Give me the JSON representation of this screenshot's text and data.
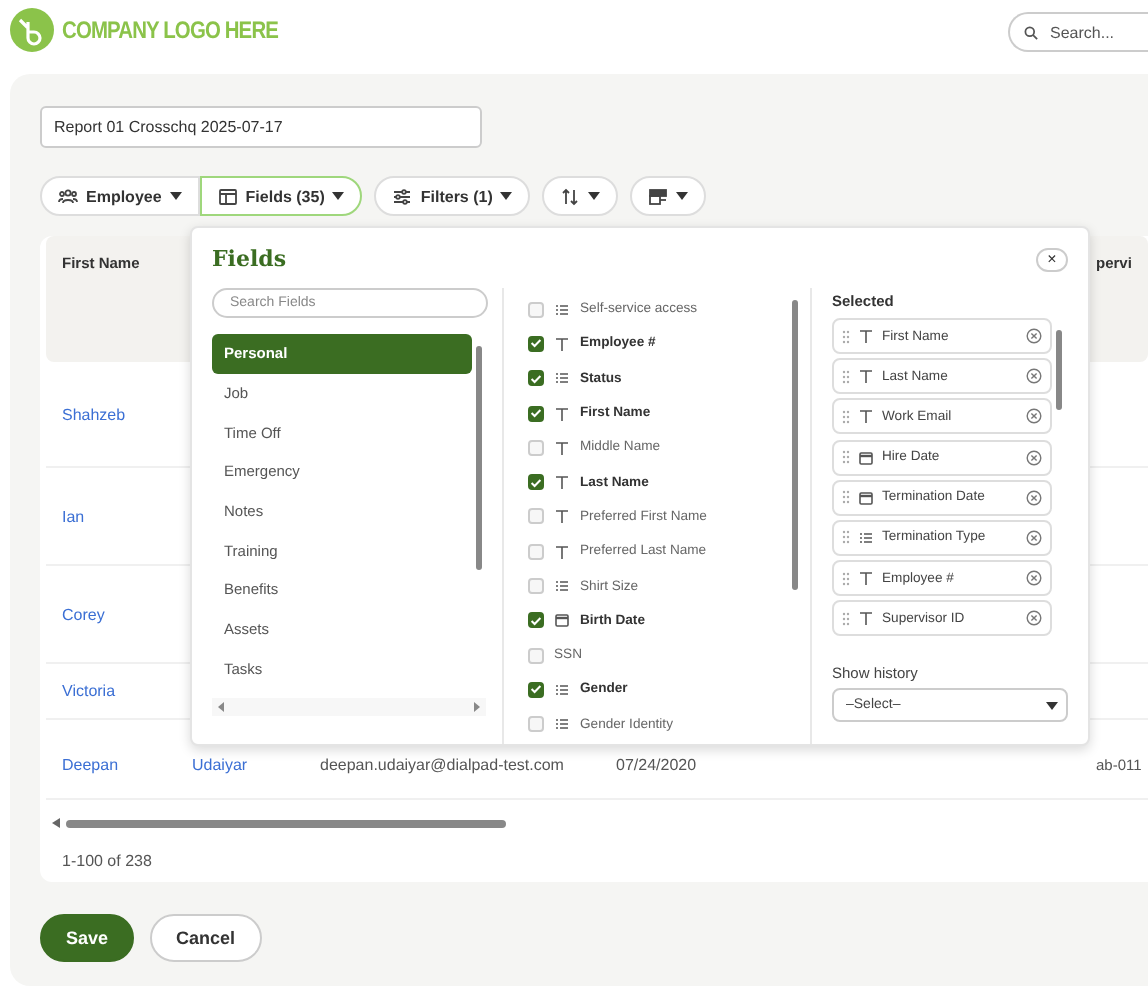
{
  "logo": {
    "text": "COMPANY LOGO HERE"
  },
  "search": {
    "placeholder": "Search..."
  },
  "report_name": {
    "value": "Report 01 Crosschq 2025-07-17"
  },
  "toolbar": {
    "segments": [
      {
        "label": "Employee",
        "selected": false
      },
      {
        "label": "Fields (35)",
        "selected": true
      }
    ],
    "buttons": [
      {
        "label": "Filters (1)"
      },
      {
        "kind": "sort"
      },
      {
        "kind": "view"
      }
    ]
  },
  "table": {
    "columns": [
      "First Name",
      "",
      "",
      "",
      "pervi"
    ],
    "rows": [
      {
        "cells": [
          "Shahzeb"
        ]
      },
      {
        "cells": [
          "Ian"
        ]
      },
      {
        "cells": [
          "Corey"
        ]
      },
      {
        "cells": [
          "Victoria"
        ]
      },
      {
        "cells": [
          "Deepan",
          "Udaiyar",
          "deepan.udaiyar@dialpad-test.com",
          "07/24/2020",
          "ab-011"
        ]
      }
    ]
  },
  "pagination": "1-100 of 238",
  "actions": [
    {
      "kind": "primary",
      "label": "Save"
    },
    {
      "kind": "secondary",
      "label": "Cancel"
    }
  ],
  "fields_panel": {
    "title": "Fields",
    "close": "×",
    "search_placeholder": "Search Fields",
    "categories": [
      {
        "label": "Personal",
        "selected": true
      },
      {
        "label": "Job",
        "selected": false
      },
      {
        "label": "Time Off",
        "selected": false
      },
      {
        "label": "Emergency",
        "selected": false
      },
      {
        "label": "Notes",
        "selected": false
      },
      {
        "label": "Training",
        "selected": false
      },
      {
        "label": "Benefits",
        "selected": false
      },
      {
        "label": "Assets",
        "selected": false
      },
      {
        "label": "Tasks",
        "selected": false
      }
    ],
    "fields": [
      {
        "label": "Self-service access",
        "kind": "list",
        "checked": false
      },
      {
        "label": "Employee #",
        "kind": "text",
        "checked": true
      },
      {
        "label": "Status",
        "kind": "list",
        "checked": true
      },
      {
        "label": "First Name",
        "kind": "text",
        "checked": true
      },
      {
        "label": "Middle Name",
        "kind": "text",
        "checked": false
      },
      {
        "label": "Last Name",
        "kind": "text",
        "checked": true
      },
      {
        "label": "Preferred First Name",
        "kind": "text",
        "checked": false
      },
      {
        "label": "Preferred Last Name",
        "kind": "text",
        "checked": false
      },
      {
        "label": "Shirt Size",
        "kind": "list",
        "checked": false
      },
      {
        "label": "Birth Date",
        "kind": "date",
        "checked": true
      },
      {
        "label": "SSN",
        "kind": "plain",
        "checked": false
      },
      {
        "label": "Gender",
        "kind": "list",
        "checked": true
      },
      {
        "label": "Gender Identity",
        "kind": "list",
        "checked": false
      }
    ],
    "selected_title": "Selected",
    "selected_fields": [
      {
        "label": "First Name",
        "kind": "text"
      },
      {
        "label": "Last Name",
        "kind": "text"
      },
      {
        "label": "Work Email",
        "kind": "text"
      },
      {
        "label": "Hire Date",
        "kind": "date"
      },
      {
        "label": "Termination Date",
        "kind": "date"
      },
      {
        "label": "Termination Type",
        "kind": "list"
      },
      {
        "label": "Employee #",
        "kind": "text"
      },
      {
        "label": "Supervisor ID",
        "kind": "text"
      }
    ],
    "history": {
      "label": "Show history",
      "value": "–Select–"
    }
  }
}
